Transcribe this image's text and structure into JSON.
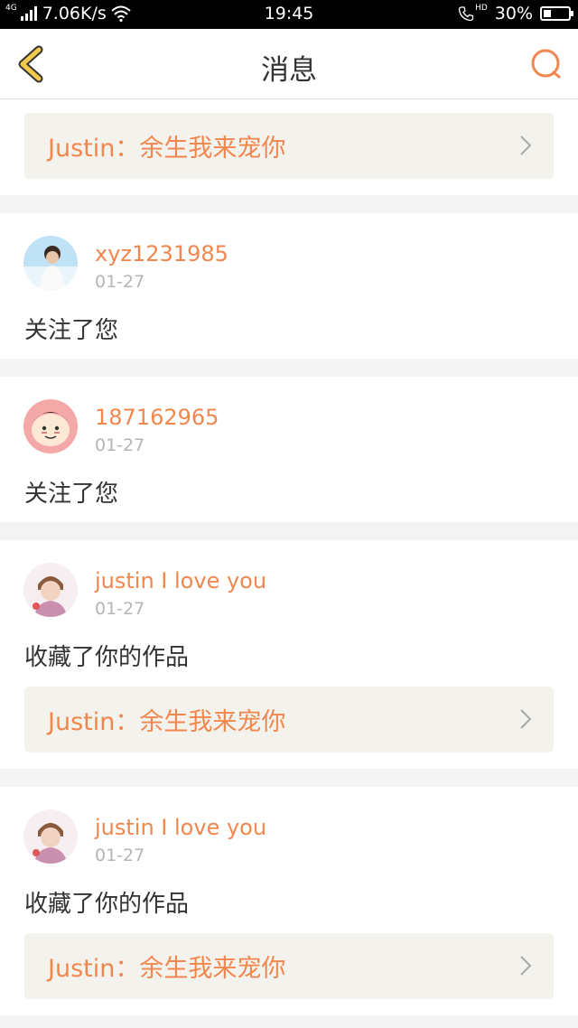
{
  "status_bar": {
    "network": "4G",
    "speed": "7.06K/s",
    "time": "19:45",
    "hd_label": "HD",
    "battery": "30%",
    "battery_level": 0.3
  },
  "nav": {
    "title": "消息",
    "back_icon": "chevron-left-icon",
    "search_icon": "search-icon"
  },
  "colors": {
    "accent": "#f0874e",
    "back_accent": "#f2c94c"
  },
  "messages": [
    {
      "link_text": "Justin：余生我来宠你"
    },
    {
      "username": "xyz1231985",
      "date": "01-27",
      "action": "关注了您"
    },
    {
      "username": "187162965",
      "date": "01-27",
      "action": "关注了您"
    },
    {
      "username": "justin I love you",
      "date": "01-27",
      "action": "收藏了你的作品",
      "link_text": "Justin：余生我来宠你"
    },
    {
      "username": "justin I love you",
      "date": "01-27",
      "action": "收藏了你的作品",
      "link_text": "Justin：余生我来宠你"
    }
  ]
}
